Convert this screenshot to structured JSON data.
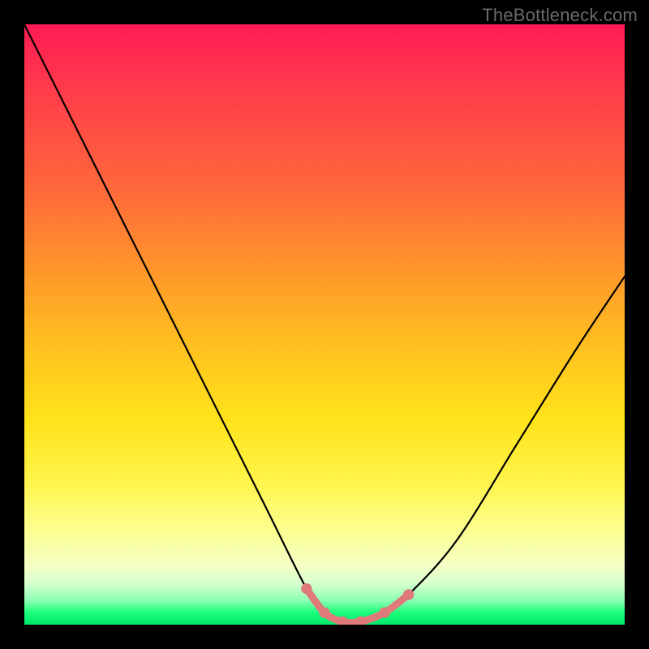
{
  "watermark": "TheBottleneck.com",
  "chart_data": {
    "type": "line",
    "title": "",
    "xlabel": "",
    "ylabel": "",
    "xlim": [
      0,
      100
    ],
    "ylim": [
      0,
      100
    ],
    "grid": false,
    "series": [
      {
        "name": "curve",
        "color": "#000000",
        "x": [
          0,
          10,
          20,
          30,
          40,
          47,
          50,
          53,
          56,
          60,
          64,
          72,
          82,
          92,
          100
        ],
        "values": [
          100,
          80,
          60,
          40,
          20,
          6,
          2,
          0.5,
          0.5,
          2,
          5,
          14,
          30,
          46,
          58
        ]
      },
      {
        "name": "flat-bottom",
        "color": "#e07a7a",
        "x": [
          47,
          50,
          53,
          56,
          60,
          64
        ],
        "values": [
          6,
          2,
          0.5,
          0.5,
          2,
          5
        ]
      }
    ],
    "flat_bottom_markers": {
      "color": "#e07a7a",
      "radius_pct": 0.9,
      "points_x": [
        47,
        50,
        53,
        56,
        60,
        64
      ],
      "points_values": [
        6,
        2,
        0.5,
        0.5,
        2,
        5
      ]
    },
    "background_gradient": {
      "stops": [
        {
          "pct": 0,
          "color": "#ff1a55"
        },
        {
          "pct": 28,
          "color": "#ff6a3a"
        },
        {
          "pct": 55,
          "color": "#ffc41e"
        },
        {
          "pct": 76,
          "color": "#fff44a"
        },
        {
          "pct": 90,
          "color": "#f6ffc4"
        },
        {
          "pct": 100,
          "color": "#00e86c"
        }
      ]
    }
  }
}
